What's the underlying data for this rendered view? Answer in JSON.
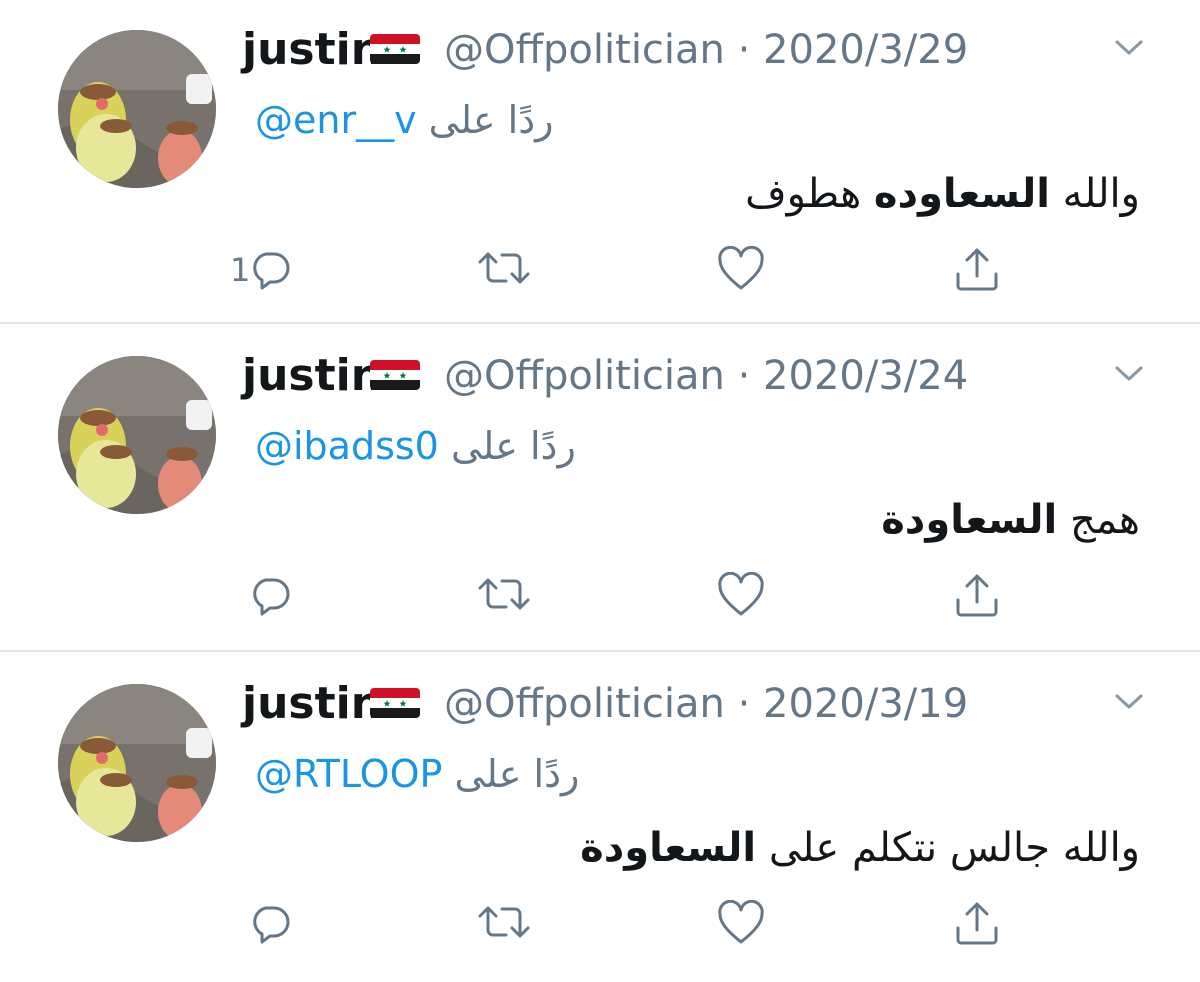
{
  "tweets": [
    {
      "name": "justin",
      "handle_time": "@Offpolitician · 2020/3/29",
      "reply_word": "ردًا على",
      "mention": "@enr__v",
      "text_plain_1": "والله ",
      "text_bold": "السعاوده",
      "text_plain_2": " هطوف",
      "reply_count": "1"
    },
    {
      "name": "justin",
      "handle_time": "@Offpolitician · 2020/3/24",
      "reply_word": "ردًا على",
      "mention": "@ibadss0",
      "text_plain_1": "همج ",
      "text_bold": "السعاودة",
      "text_plain_2": "",
      "reply_count": ""
    },
    {
      "name": "justin",
      "handle_time": "@Offpolitician · 2020/3/19",
      "reply_word": "ردًا على",
      "mention": "@RTLOOP",
      "text_plain_1": "والله جالس نتكلم على ",
      "text_bold": "السعاودة",
      "text_plain_2": "",
      "reply_count": ""
    }
  ],
  "icons": {
    "flag": "syria-flag-icon",
    "caret": "chevron-down-icon",
    "reply": "reply-icon",
    "retweet": "retweet-icon",
    "like": "heart-icon",
    "share": "share-icon"
  },
  "colors": {
    "mention": "#1b95e0",
    "muted": "#657786",
    "divider": "#e3e6e8"
  }
}
